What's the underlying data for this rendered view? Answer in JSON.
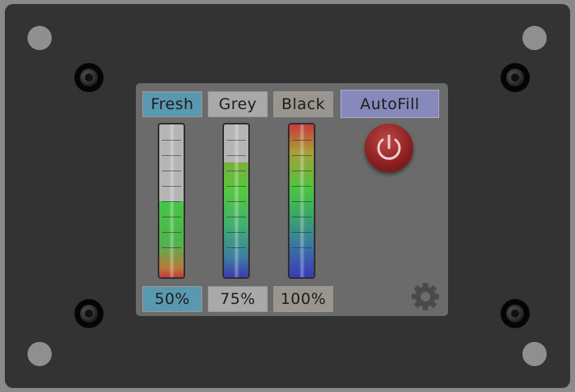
{
  "tabs": {
    "fresh": "Fresh",
    "grey": "Grey",
    "black": "Black"
  },
  "autofill_label": "AutoFill",
  "tanks": [
    {
      "name": "Fresh",
      "level_percent": 50,
      "label": "50%"
    },
    {
      "name": "Grey",
      "level_percent": 75,
      "label": "75%"
    },
    {
      "name": "Black",
      "level_percent": 100,
      "label": "100%"
    }
  ],
  "icons": {
    "power": "power-icon",
    "settings": "gear-icon"
  },
  "colors": {
    "fresh": "#5a98b0",
    "grey": "#a9a9a9",
    "black": "#9b9590",
    "autofill": "#8789ba",
    "power": "#a02828"
  }
}
